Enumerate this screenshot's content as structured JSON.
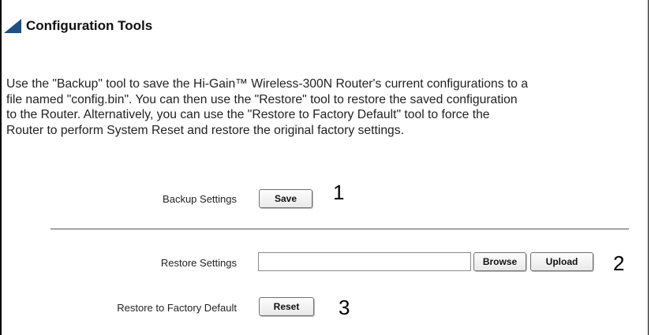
{
  "section": {
    "title": "Configuration Tools",
    "description_lines": [
      "Use the \"Backup\" tool to save the Hi-Gain™ Wireless-300N Router's current configurations to a",
      "file named \"config.bin\". You can then use the \"Restore\" tool to restore the saved configuration",
      "to the Router. Alternatively, you can use the \"Restore to Factory Default\" tool to force the",
      "Router to perform System Reset and restore the original factory settings."
    ]
  },
  "backup": {
    "label": "Backup Settings",
    "button_label": "Save",
    "marker": "1"
  },
  "restore": {
    "label": "Restore Settings",
    "file_value": "",
    "browse_label": "Browse",
    "upload_label": "Upload",
    "marker": "2"
  },
  "factory_reset": {
    "label": "Restore to Factory Default",
    "button_label": "Reset",
    "marker": "3"
  },
  "colors": {
    "title_marker": "#1f4f83"
  }
}
